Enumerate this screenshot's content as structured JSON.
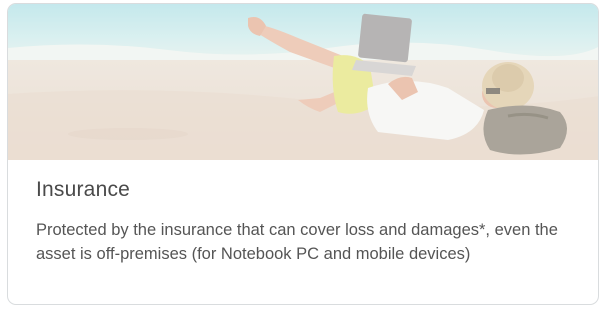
{
  "card": {
    "title": "Insurance",
    "description": "Protected by the insurance that can cover loss and damages*, even the asset is off-premises (for Notebook PC and mobile devices)",
    "image_subject": "person-relaxing-on-beach-with-laptop"
  },
  "colors": {
    "card_border": "#d9dcde",
    "title_text": "#4a4a4a",
    "body_text": "#555555",
    "sand": "#e6d7c8",
    "sea": "#bfe3e6"
  }
}
